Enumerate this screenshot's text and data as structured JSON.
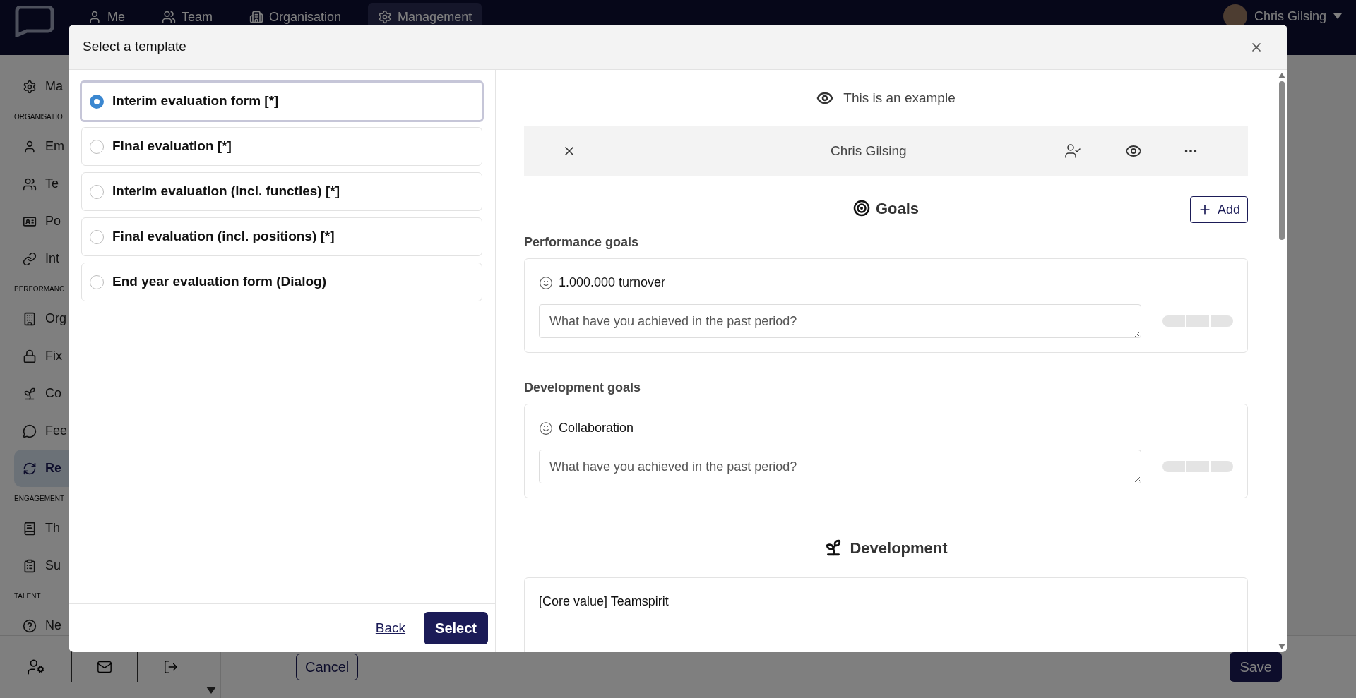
{
  "nav": {
    "items": [
      {
        "label": "Me",
        "selected": false
      },
      {
        "label": "Team",
        "selected": false
      },
      {
        "label": "Organisation",
        "selected": false
      },
      {
        "label": "Management",
        "selected": true
      }
    ],
    "user": "Chris Gilsing"
  },
  "sidebar": {
    "items": [
      {
        "kind": "item",
        "label": "Ma",
        "selected": false
      },
      {
        "kind": "section",
        "label": "ORGANISATIO"
      },
      {
        "kind": "item",
        "label": "Em",
        "selected": false
      },
      {
        "kind": "item",
        "label": "Te",
        "selected": false
      },
      {
        "kind": "item",
        "label": "Po",
        "selected": false
      },
      {
        "kind": "item",
        "label": "Int",
        "selected": false
      },
      {
        "kind": "section",
        "label": "PERFORMANC"
      },
      {
        "kind": "item",
        "label": "Org",
        "selected": false
      },
      {
        "kind": "item",
        "label": "Fix",
        "selected": false
      },
      {
        "kind": "item",
        "label": "Co",
        "selected": false
      },
      {
        "kind": "item",
        "label": "Fee",
        "selected": false
      },
      {
        "kind": "item",
        "label": "Re",
        "selected": true
      },
      {
        "kind": "section",
        "label": "ENGAGEMENT"
      },
      {
        "kind": "item",
        "label": "Th",
        "selected": false
      },
      {
        "kind": "item",
        "label": "Su",
        "selected": false
      },
      {
        "kind": "section",
        "label": "TALENT"
      },
      {
        "kind": "item",
        "label": "Ne",
        "selected": false
      }
    ]
  },
  "footer": {
    "cancel": "Cancel",
    "save": "Save"
  },
  "modal": {
    "title": "Select a template",
    "templates": [
      {
        "label": "Interim evaluation form [*]",
        "selected": true
      },
      {
        "label": "Final evaluation [*]",
        "selected": false
      },
      {
        "label": "Interim evaluation (incl. functies) [*]",
        "selected": false
      },
      {
        "label": "Final evaluation (incl. positions) [*]",
        "selected": false
      },
      {
        "label": "End year evaluation form (Dialog)",
        "selected": false
      }
    ],
    "back": "Back",
    "select": "Select",
    "preview": {
      "notice": "This is an example",
      "person": "Chris Gilsing",
      "sections": [
        {
          "kind": "goals",
          "title": "Goals",
          "add": "Add",
          "groups": [
            {
              "title": "Performance goals",
              "goals": [
                {
                  "title": "1.000.000 turnover",
                  "placeholder": "What have you achieved in the past period?"
                }
              ]
            },
            {
              "title": "Development goals",
              "goals": [
                {
                  "title": "Collaboration",
                  "placeholder": "What have you achieved in the past period?"
                }
              ]
            }
          ]
        },
        {
          "kind": "development",
          "title": "Development",
          "items": [
            "[Core value] Teamspirit"
          ]
        }
      ]
    }
  }
}
